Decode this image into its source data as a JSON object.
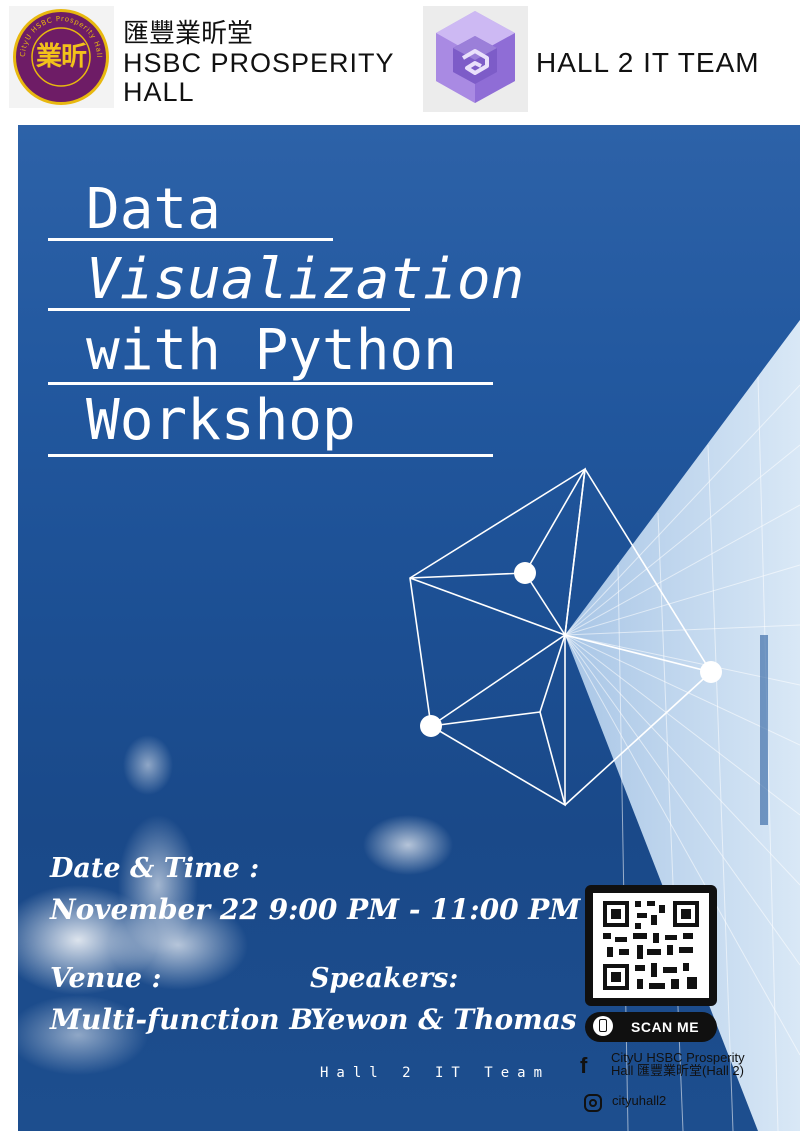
{
  "header": {
    "hall_logo_chars": "業昕",
    "hall_logo_ring_text": "CityU HSBC Prosperity Hall",
    "hall_name_zh": "匯豐業昕堂",
    "hall_name_en_line1": "HSBC PROSPERITY",
    "hall_name_en_line2": "HALL",
    "team_name": "HALL 2 IT TEAM",
    "team_logo_icon": "purple-cube-logo"
  },
  "poster": {
    "title_line1": "Data",
    "title_line2": "Visualization",
    "title_line3": "with Python",
    "title_line4": "Workshop",
    "date_label": "Date & Time :",
    "date_value": "November 22 9:00 PM - 11:00 PM",
    "venue_label": "Venue :",
    "venue_value": "Multi-function B",
    "speakers_label": "Speakers:",
    "speakers_value": "Yewon & Thomas",
    "credit": "Hall 2 IT Team"
  },
  "contact": {
    "scan_label": "SCAN ME",
    "facebook_line1": "CityU HSBC Prosperity",
    "facebook_line2": "Hall 匯豐業昕堂(Hall 2)",
    "instagram": "cityuhall2",
    "facebook_icon": "facebook-icon",
    "instagram_icon": "instagram-icon",
    "qr_icon": "qr-code"
  },
  "colors": {
    "poster_blue": "#22589f",
    "logo_purple": "#6e1c66",
    "logo_gold": "#e8b80f",
    "team_logo_purple": "#9b7fd9"
  }
}
